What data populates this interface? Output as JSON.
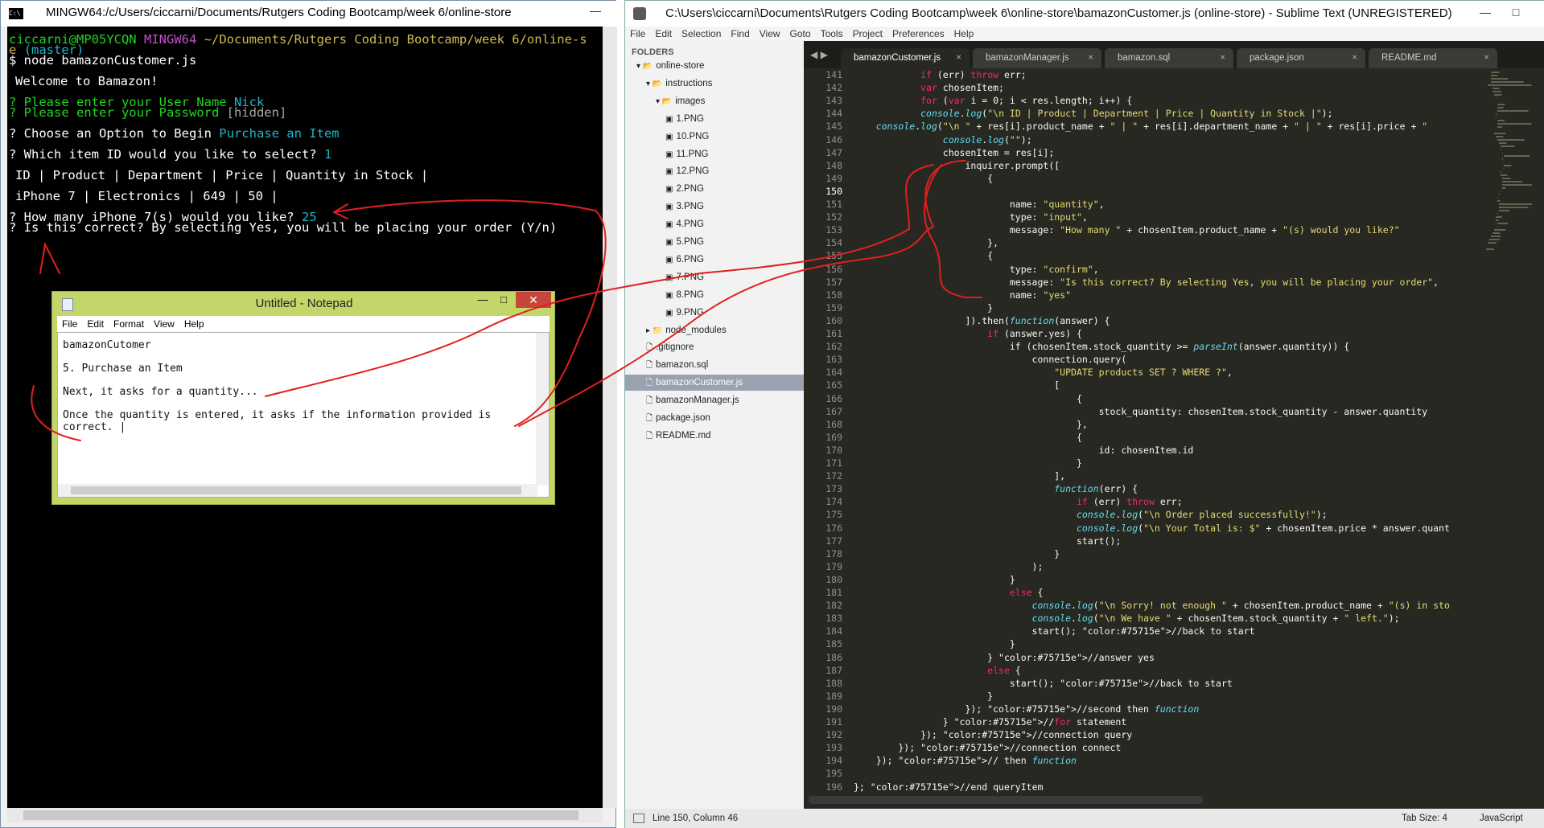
{
  "terminal": {
    "title": "MINGW64:/c/Users/ciccarni/Documents/Rutgers Coding Bootcamp/week 6/online-store",
    "prompt_user": "ciccarni@MP05YCQN",
    "prompt_sys": "MINGW64",
    "prompt_path": "~/Documents/Rutgers Coding Bootcamp/week 6/online-s",
    "prompt_path2": "e",
    "prompt_branch": "(master)",
    "command": "$ node bamazonCustomer.js",
    "welcome": "Welcome to Bamazon!",
    "q_user": "? Please enter your User Name ",
    "a_user": "Nick",
    "q_pass": "? Please enter your Password ",
    "a_pass": "[hidden]",
    "q_option": "? Choose an Option to Begin ",
    "a_option": "Purchase an Item",
    "q_item": "? Which item ID would you like to select? ",
    "a_item": "1",
    "header_row": "ID | Product | Department | Price | Quantity in Stock |",
    "data_row": "iPhone 7 | Electronics | 649 | 50 |",
    "q_qty": "? How many iPhone 7(s) would you like? ",
    "a_qty": "25",
    "q_confirm": "? Is this correct? By selecting Yes, you will be placing your order (Y/n)"
  },
  "notepad": {
    "title": "Untitled - Notepad",
    "menu": [
      "File",
      "Edit",
      "Format",
      "View",
      "Help"
    ],
    "lines": [
      "bamazonCutomer",
      "",
      "5. Purchase an Item",
      "",
      "Next, it asks for a quantity...",
      "",
      "Once the quantity is entered, it asks if the information provided is",
      "correct. |"
    ]
  },
  "sublime": {
    "title": "C:\\Users\\ciccarni\\Documents\\Rutgers Coding Bootcamp\\week 6\\online-store\\bamazonCustomer.js (online-store) - Sublime Text (UNREGISTERED)",
    "menu": [
      "File",
      "Edit",
      "Selection",
      "Find",
      "View",
      "Goto",
      "Tools",
      "Project",
      "Preferences",
      "Help"
    ],
    "folders_label": "FOLDERS",
    "tree": [
      {
        "label": "online-store",
        "indent": 0,
        "type": "folder-open"
      },
      {
        "label": "instructions",
        "indent": 1,
        "type": "folder-open"
      },
      {
        "label": "images",
        "indent": 2,
        "type": "folder-open"
      },
      {
        "label": "1.PNG",
        "indent": 3,
        "type": "image"
      },
      {
        "label": "10.PNG",
        "indent": 3,
        "type": "image"
      },
      {
        "label": "11.PNG",
        "indent": 3,
        "type": "image"
      },
      {
        "label": "12.PNG",
        "indent": 3,
        "type": "image"
      },
      {
        "label": "2.PNG",
        "indent": 3,
        "type": "image"
      },
      {
        "label": "3.PNG",
        "indent": 3,
        "type": "image"
      },
      {
        "label": "4.PNG",
        "indent": 3,
        "type": "image"
      },
      {
        "label": "5.PNG",
        "indent": 3,
        "type": "image"
      },
      {
        "label": "6.PNG",
        "indent": 3,
        "type": "image"
      },
      {
        "label": "7.PNG",
        "indent": 3,
        "type": "image"
      },
      {
        "label": "8.PNG",
        "indent": 3,
        "type": "image"
      },
      {
        "label": "9.PNG",
        "indent": 3,
        "type": "image"
      },
      {
        "label": "node_modules",
        "indent": 1,
        "type": "folder-closed"
      },
      {
        "label": ".gitignore",
        "indent": 1,
        "type": "file"
      },
      {
        "label": "bamazon.sql",
        "indent": 1,
        "type": "file"
      },
      {
        "label": "bamazonCustomer.js",
        "indent": 1,
        "type": "file",
        "selected": true
      },
      {
        "label": "bamazonManager.js",
        "indent": 1,
        "type": "file"
      },
      {
        "label": "package.json",
        "indent": 1,
        "type": "file"
      },
      {
        "label": "README.md",
        "indent": 1,
        "type": "file"
      }
    ],
    "tabs": [
      {
        "label": "bamazonCustomer.js",
        "active": true
      },
      {
        "label": "bamazonManager.js",
        "active": false
      },
      {
        "label": "bamazon.sql",
        "active": false
      },
      {
        "label": "package.json",
        "active": false
      },
      {
        "label": "README.md",
        "active": false
      }
    ],
    "first_line": 141,
    "code_lines": [
      "            if (err) throw err;",
      "            var chosenItem;",
      "            for (var i = 0; i < res.length; i++) {",
      "            console.log(\"\\n ID | Product | Department | Price | Quantity in Stock |\");",
      "    console.log(\"\\n \" + res[i].product_name + \" | \" + res[i].department_name + \" | \" + res[i].price + \"",
      "                console.log(\"\");",
      "                chosenItem = res[i];",
      "                    inquirer.prompt([",
      "                        {",
      "",
      "                            name: \"quantity\",",
      "                            type: \"input\",",
      "                            message: \"How many \" + chosenItem.product_name + \"(s) would you like?\"",
      "                        },",
      "                        {",
      "                            type: \"confirm\",",
      "                            message: \"Is this correct? By selecting Yes, you will be placing your order\",",
      "                            name: \"yes\"",
      "                        }",
      "                    ]).then(function(answer) {",
      "                        if (answer.yes) {",
      "                            if (chosenItem.stock_quantity >= parseInt(answer.quantity)) {",
      "                                connection.query(",
      "                                    \"UPDATE products SET ? WHERE ?\",",
      "                                    [",
      "                                        {",
      "                                            stock_quantity: chosenItem.stock_quantity - answer.quantity",
      "                                        },",
      "                                        {",
      "                                            id: chosenItem.id",
      "                                        }",
      "                                    ],",
      "                                    function(err) {",
      "                                        if (err) throw err;",
      "                                        console.log(\"\\n Order placed successfully!\");",
      "                                        console.log(\"\\n Your Total is: $\" + chosenItem.price * answer.quant",
      "                                        start();",
      "                                    }",
      "                                );",
      "                            }",
      "                            else {",
      "                                console.log(\"\\n Sorry! not enough \" + chosenItem.product_name + \"(s) in sto",
      "                                console.log(\"\\n We have \" + chosenItem.stock_quantity + \" left.\");",
      "                                start(); //back to start",
      "                            }",
      "                        } //answer yes",
      "                        else {",
      "                            start(); //back to start",
      "                        }",
      "                    }); //second then function",
      "                } //for statement",
      "            }); //connection query",
      "        }); //connection connect",
      "    }); // then function",
      "",
      "}; //end queryItem",
      ""
    ],
    "status_left": "Line 150, Column 46",
    "status_tab": "Tab Size: 4",
    "status_lang": "JavaScript"
  },
  "colors": {
    "annotation": "#e02020",
    "keyword": "#f92672",
    "string": "#e6db74",
    "func": "#66d9ef",
    "comment": "#75715e"
  }
}
